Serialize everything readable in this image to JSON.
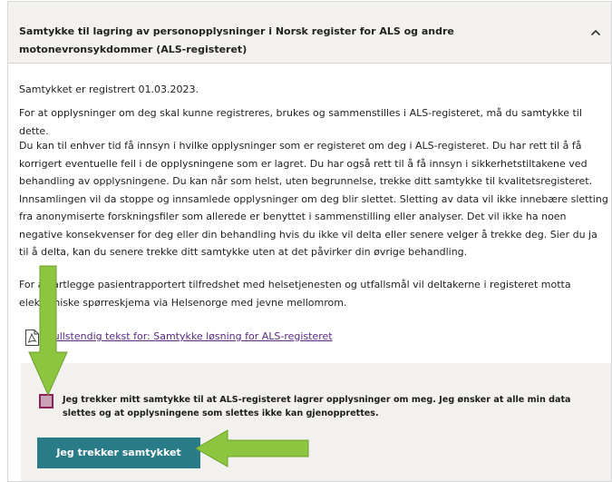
{
  "accordion": {
    "title": "Samtykke til lagring av personopplysninger i Norsk register for ALS og andre motonevronsykdommer (ALS-registeret)",
    "expanded": true,
    "chevron_icon": "chevron-up-icon"
  },
  "content": {
    "registered": "Samtykket er registrert 01.03.2023.",
    "intro": "For at opplysninger om deg skal kunne registreres, brukes og sammenstilles i ALS-registeret, må du samtykke til dette.",
    "rights": "Du kan til enhver tid få innsyn i hvilke opplysninger som er registeret om deg i ALS-registeret. Du har rett til å få korrigert eventuelle feil i de opplysningene som er lagret. Du har også rett til å få innsyn i sikkerhetstiltakene ved behandling av opplysningene. Du kan når som helst, uten begrunnelse, trekke ditt samtykke til kvalitetsregisteret. Innsamlingen vil da stoppe og innsamlede opplysninger om deg blir slettet. Sletting av data vil ikke innebære sletting fra anonymiserte forskningsfiler som allerede er benyttet i sammenstilling eller analyser. Det vil ikke ha noen negative konsekvenser for deg eller din behandling hvis du ikke vil delta eller senere velger å trekke deg. Sier du ja til å delta, kan du senere trekke ditt samtykke uten at det påvirker din øvrige behandling.",
    "survey": "For å kartlegge pasientrapportert tilfredshet med helsetjenesten og utfallsmål vil deltakerne i registeret motta elektroniske spørreskjema via Helsenorge med jevne mellomrom.",
    "doc_link": "Fullstendig tekst for: Samtykke løsning for ALS-registeret",
    "doc_icon": "pdf-document-icon"
  },
  "withdraw": {
    "checkbox_checked": true,
    "checkbox_label": "Jeg trekker mitt samtykke til at ALS-registeret lagrer opplysninger om meg. Jeg ønsker at alle min data slettes og at opplysningene som slettes ikke kan gjenopprettes.",
    "button_label": "Jeg trekker samtykket"
  },
  "colors": {
    "header_bg": "#f4f2ee",
    "link": "#5a2a82",
    "button": "#2a7b88",
    "checkbox_border": "#8a2257",
    "annotation_arrow": "#8cc63f"
  },
  "annotations": [
    "arrow-down-icon",
    "arrow-left-icon"
  ]
}
